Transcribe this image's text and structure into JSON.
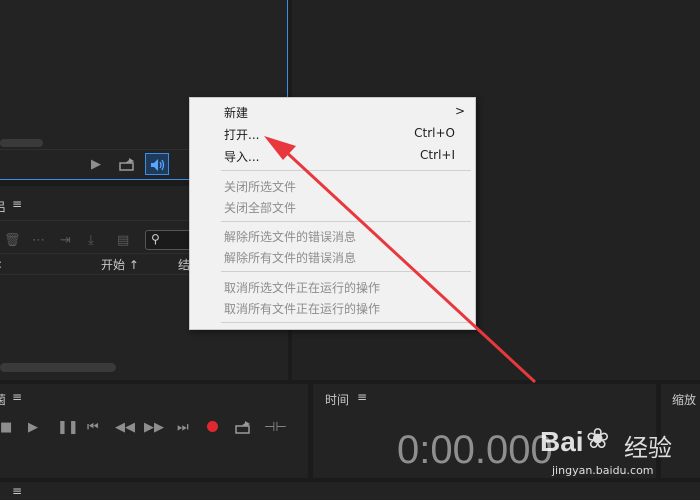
{
  "context_menu": {
    "items": [
      {
        "label": "新建",
        "shortcut": "",
        "has_submenu": true,
        "enabled": true
      },
      {
        "label": "打开...",
        "shortcut": "Ctrl+O",
        "enabled": true
      },
      {
        "label": "导入...",
        "shortcut": "Ctrl+I",
        "enabled": true
      },
      {
        "label": "关闭所选文件",
        "shortcut": "",
        "enabled": false
      },
      {
        "label": "关闭全部文件",
        "shortcut": "",
        "enabled": false
      },
      {
        "label": "解除所选文件的错误消息",
        "shortcut": "",
        "enabled": false
      },
      {
        "label": "解除所有文件的错误消息",
        "shortcut": "",
        "enabled": false
      },
      {
        "label": "取消所选文件正在运行的操作",
        "shortcut": "",
        "enabled": false
      },
      {
        "label": "取消所有文件正在运行的操作",
        "shortcut": "",
        "enabled": false
      }
    ],
    "submenu_arrow": ">"
  },
  "queue_panel": {
    "title_fragment": "吕",
    "col_start": "开始",
    "col_end_fragment": "结",
    "col_left_fragment": ":",
    "search_icon": "search-icon"
  },
  "preview_panel": {
    "controls": [
      "play-icon",
      "export-icon",
      "audio-icon"
    ]
  },
  "transport_panel": {
    "title_fragment": "菌",
    "controls": [
      "stop-icon",
      "play-icon",
      "pause-icon",
      "step-back-icon",
      "rewind-icon",
      "fast-forward-icon",
      "step-forward-icon",
      "record-icon",
      "export-icon",
      "split-icon"
    ],
    "record_color": "#e0282e"
  },
  "time_panel": {
    "title": "时间",
    "timecode": "0:00.000"
  },
  "zoom_panel": {
    "title": "缩放"
  },
  "watermark": {
    "text_brand": "Bai",
    "text_cn": "经验",
    "url": "jingyan.baidu.com"
  },
  "menu_icon": "≡",
  "accent_color": "#3d8ee6",
  "arrow_color": "#e8383d"
}
